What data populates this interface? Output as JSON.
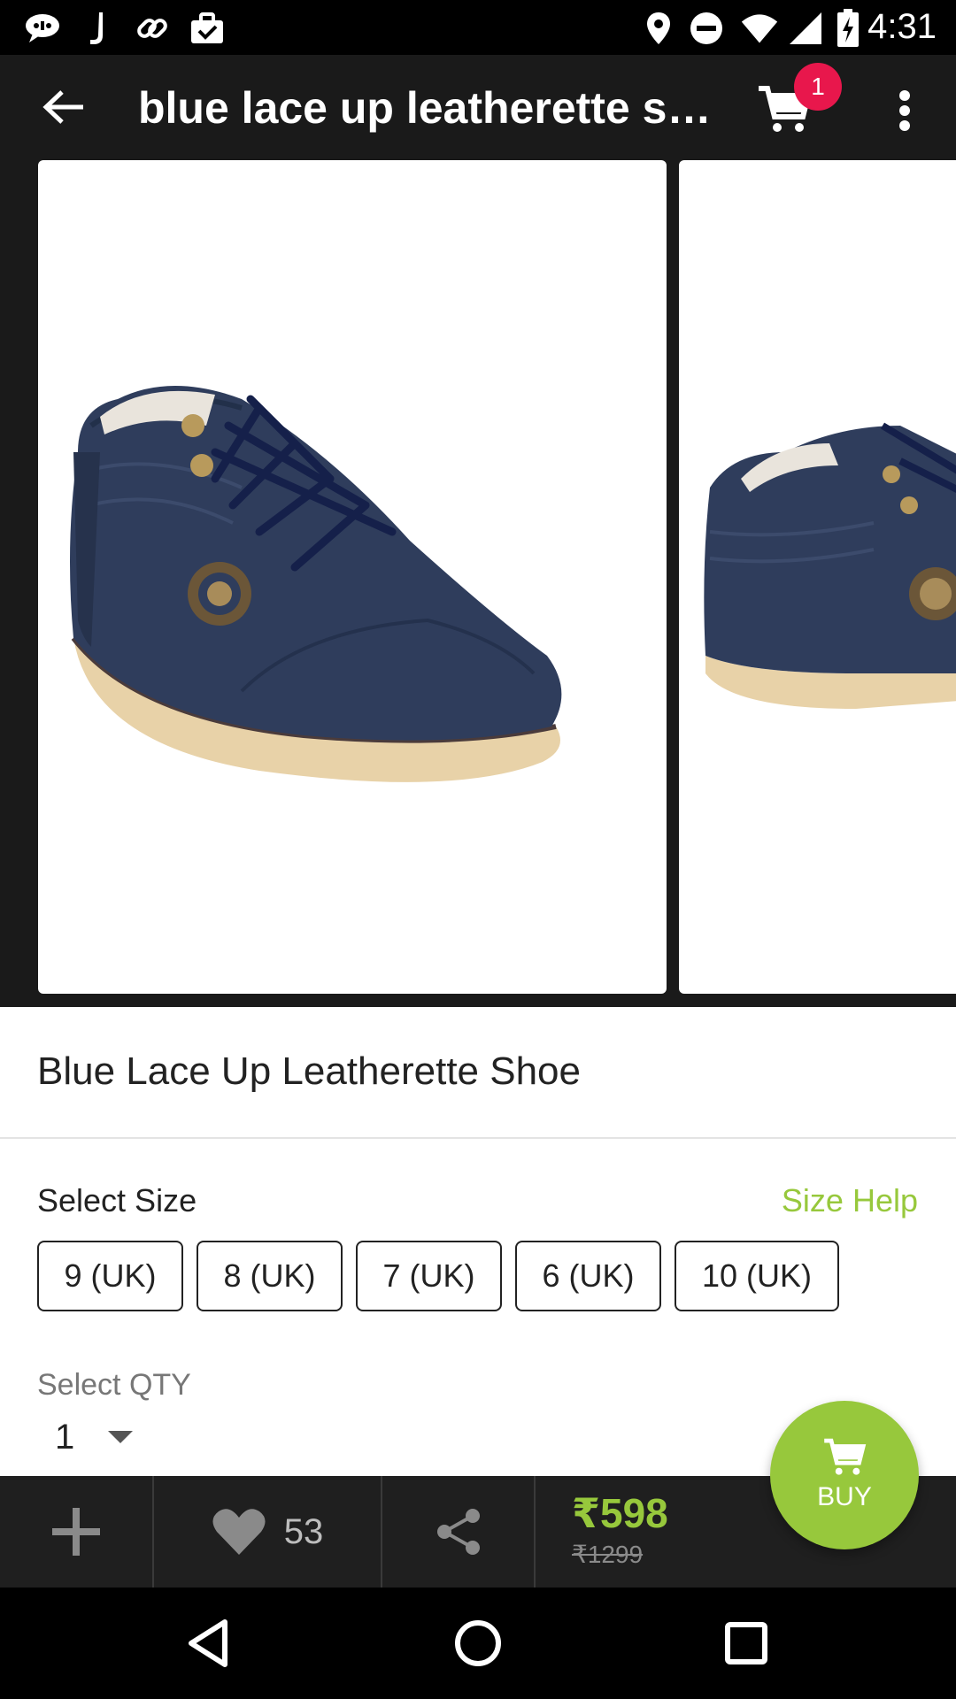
{
  "status_bar": {
    "time": "4:31",
    "left_icons": [
      "chat-icon",
      "j-icon",
      "link-icon",
      "briefcase-check-icon"
    ],
    "right_icons": [
      "location-icon",
      "do-not-disturb-icon",
      "wifi-icon",
      "signal-icon",
      "battery-charging-icon"
    ]
  },
  "app_bar": {
    "title": "blue lace up leatherette sh…",
    "cart_count": "1"
  },
  "product": {
    "name": "Blue Lace Up Leatherette Shoe"
  },
  "size": {
    "label": "Select Size",
    "help_label": "Size Help",
    "options": [
      "9 (UK)",
      "8 (UK)",
      "7 (UK)",
      "6 (UK)",
      "10 (UK)"
    ]
  },
  "qty": {
    "label": "Select QTY",
    "value": "1"
  },
  "actions": {
    "like_count": "53",
    "price": "₹598",
    "original_price": "₹1299",
    "buy_label": "BUY"
  },
  "colors": {
    "accent_green": "#97c83c",
    "badge_red": "#e8174c",
    "bar_dark": "#1f1f1f"
  }
}
